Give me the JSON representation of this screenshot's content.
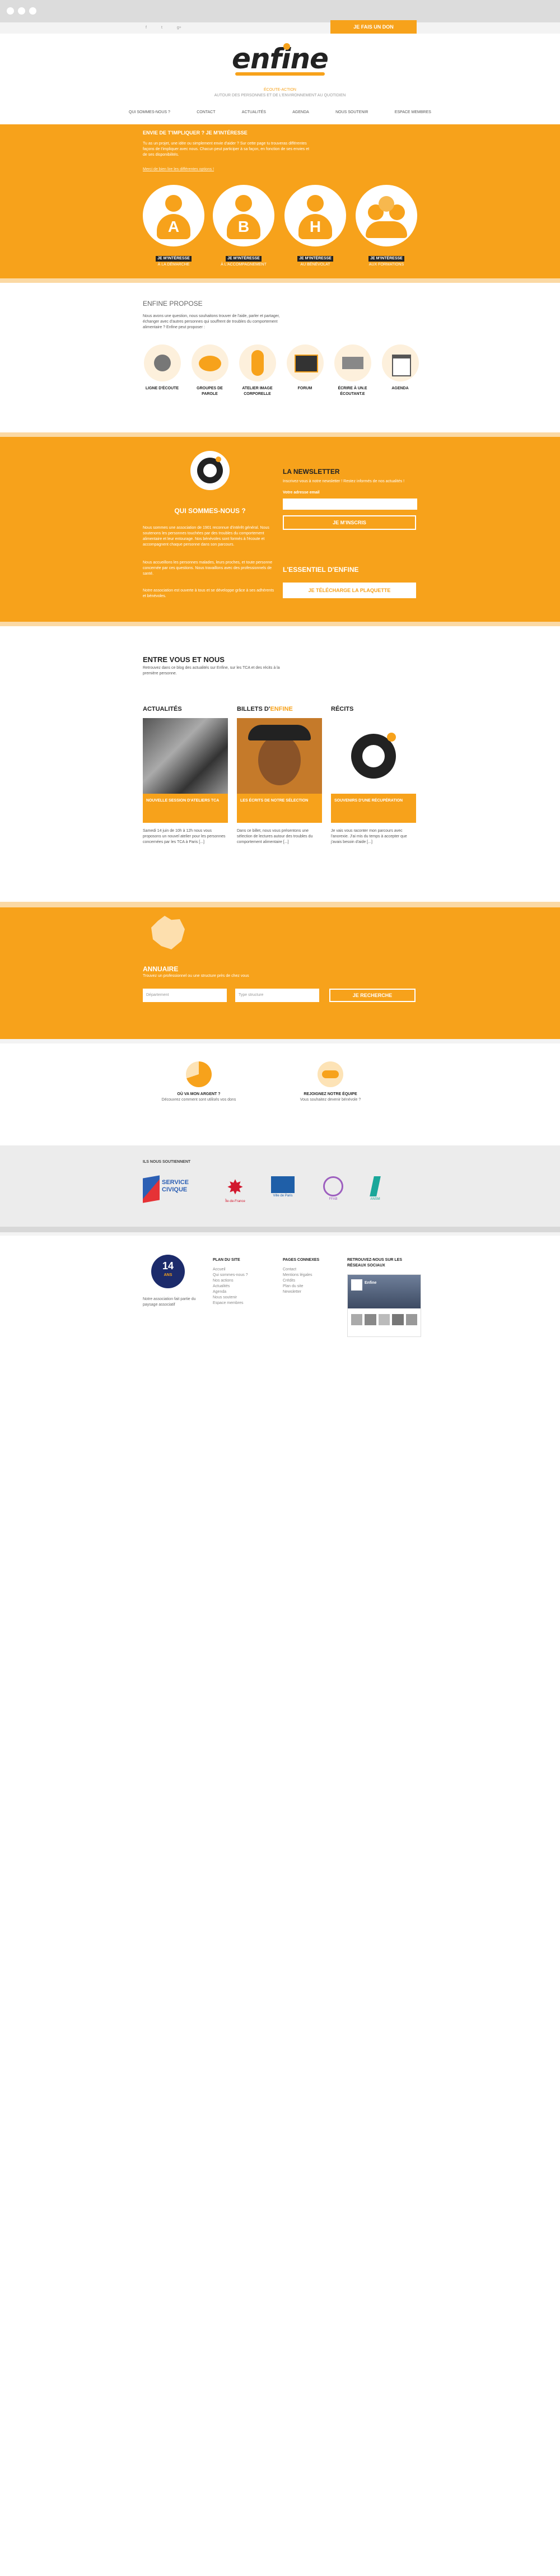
{
  "window": {
    "dots": [
      "close",
      "minimize",
      "maximize"
    ]
  },
  "header": {
    "social": [
      "f",
      "t",
      "g+"
    ],
    "cta_label": "JE FAIS UN DON",
    "logo_text": "enfine",
    "tagline_1": "ÉCOUTE-ACTION",
    "tagline_2": "AUTOUR DES PERSONNES ET DE L'ENVIRONNEMENT AU QUOTIDIEN",
    "nav": [
      "QUI SOMMES-NOUS ?",
      "CONTACT",
      "ACTUALITÉS",
      "AGENDA",
      "NOUS SOUTENIR",
      "ESPACE MEMBRES"
    ]
  },
  "hero": {
    "title": "ENVIE DE T'IMPLIQUER ? JE M'INTÉRESSE",
    "text": "Tu as un projet, une idée ou simplement envie d'aider ? Sur cette page tu trouveras différentes façons de t'impliquer avec nous. Chacun peut participer à sa façon, en fonction de ses envies et de ses disponibilités.",
    "link": "Merci de bien lire les différentes options !",
    "cards": [
      {
        "letter": "A",
        "title": "JE M'INTÉRESSE",
        "sub": "À LA DÉMARCHE"
      },
      {
        "letter": "B",
        "title": "JE M'INTÉRESSE",
        "sub": "À L'ACCOMPAGNEMENT"
      },
      {
        "letter": "H",
        "title": "JE M'INTÉRESSE",
        "sub": "AU BÉNÉVOLAT"
      },
      {
        "letter": "",
        "title": "JE M'INTÉRESSE",
        "sub": "AUX FORMATIONS"
      }
    ]
  },
  "propose": {
    "title": "ENFINE PROPOSE",
    "text": "Nous avons une question, nous souhaitons trouver de l'aide, parler et partager, échanger avec d'autres personnes qui souffrent de troubles du comportement alimentaire ? Enfine peut proposer :",
    "items": [
      "LIGNE D'ÉCOUTE",
      "GROUPES DE PAROLE",
      "ATELIER IMAGE CORPORELLE",
      "FORUM",
      "ÉCRIRE À UN.E ÉCOUTANT.E",
      "AGENDA"
    ]
  },
  "about": {
    "title": "QUI SOMMES-NOUS ?",
    "p1": "Nous sommes une association de 1901 reconnue d'intérêt général. Nous soutenons les personnes touchées par des troubles du comportement alimentaire et leur entourage. Nos bénévoles sont formés à l'écoute et accompagnent chaque personne dans son parcours.",
    "p2": "Nous accueillons les personnes malades, leurs proches, et toute personne concernée par ces questions. Nous travaillons avec des professionnels de santé.",
    "p3": "Notre association est ouverte à tous et se développe grâce à ses adhérents et bénévoles.",
    "newsletter_title": "LA NEWSLETTER",
    "newsletter_text": "Inscrivez-vous à notre newsletter ! Restez informés de nos actualités !",
    "newsletter_label": "Votre adresse email",
    "newsletter_placeholder": "",
    "newsletter_button": "JE M'INSCRIS",
    "essential_title": "L'ESSENTIEL D'ENFINE",
    "essential_button": "JE TÉLÉCHARGE LA PLAQUETTE"
  },
  "blog": {
    "title": "ENTRE VOUS ET NOUS",
    "text": "Retrouvez dans ce blog des actualités sur Enfine, sur les TCA et des récits à la première personne.",
    "cols": [
      {
        "heading": "ACTUALITÉS",
        "accent": "",
        "caption": "NOUVELLE SESSION D'ATELIERS TCA",
        "excerpt": "Samedi 14 juin de 10h à 12h nous vous proposons un nouvel atelier pour les personnes concernées par les TCA à Paris [...]"
      },
      {
        "heading": "BILLETS D'",
        "accent": "ENFINE",
        "caption": "LES ÉCRITS DE NOTRE SÉLECTION",
        "excerpt": "Dans ce billet, nous vous présentons une sélection de lectures autour des troubles du comportement alimentaire [...]"
      },
      {
        "heading": "RÉCITS",
        "accent": "",
        "caption": "SOUVENIRS D'UNE RÉCUPÉRATION",
        "excerpt": "Je vais vous raconter mon parcours avec l'anorexie. J'ai mis du temps à accepter que j'avais besoin d'aide [...]"
      }
    ]
  },
  "directory": {
    "title": "ANNUAIRE",
    "text": "Trouvez un professionnel ou une structure près de chez vous",
    "select_1": "Département",
    "select_2": "Type structure",
    "button": "JE RECHERCHE"
  },
  "support": [
    {
      "title": "OÙ VA MON ARGENT ?",
      "text": "Découvrez comment sont utilisés vos dons"
    },
    {
      "title": "REJOIGNEZ NOTRE ÉQUIPE",
      "text": "Vous souhaitez devenir bénévole ?"
    }
  ],
  "partners": {
    "title": "ILS NOUS SOUTIENNENT",
    "names": [
      "SERVICE CIVIQUE",
      "Île-de-France",
      "Ville de Paris",
      "FFAB",
      "ANSM"
    ]
  },
  "footer": {
    "badge_1": "14",
    "badge_2": "ANS",
    "badge_text": "Notre association fait partie du paysage associatif",
    "col1_title": "PLAN DU SITE",
    "col1": [
      "Accueil",
      "Qui sommes-nous ?",
      "Nos actions",
      "Actualités",
      "Agenda",
      "Nous soutenir",
      "Espace membres"
    ],
    "col2_title": "PAGES CONNEXES",
    "col2": [
      "Contact",
      "Mentions légales",
      "Crédits",
      "Plan du site",
      "Newsletter"
    ],
    "col3_title": "RETROUVEZ-NOUS SUR LES RÉSEAUX SOCIAUX",
    "fb_name": "Enfine"
  },
  "colors": {
    "accent": "#f7a21b",
    "dark": "#222222"
  }
}
